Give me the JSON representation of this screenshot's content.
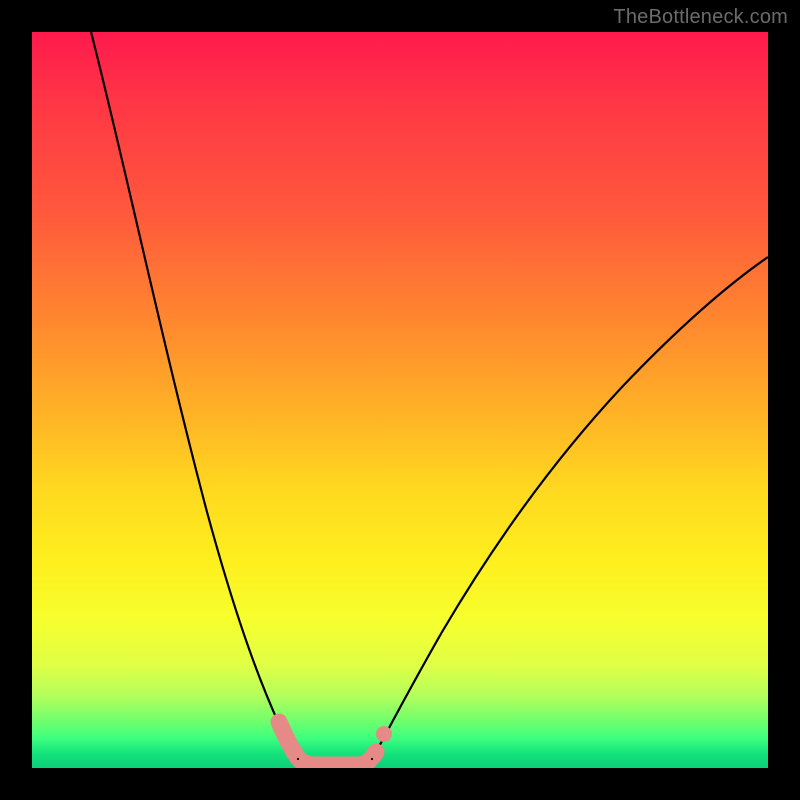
{
  "watermark": "TheBottleneck.com",
  "chart_data": {
    "type": "line",
    "title": "",
    "xlabel": "",
    "ylabel": "",
    "xlim": [
      0,
      100
    ],
    "ylim": [
      0,
      100
    ],
    "gradient_stops": [
      {
        "pos": 0,
        "color": "#ff1a4d"
      },
      {
        "pos": 25,
        "color": "#ff5a3c"
      },
      {
        "pos": 52,
        "color": "#ffb326"
      },
      {
        "pos": 72,
        "color": "#feef1e"
      },
      {
        "pos": 90,
        "color": "#b6ff5a"
      },
      {
        "pos": 100,
        "color": "#0ccf78"
      }
    ],
    "series": [
      {
        "name": "left-curve",
        "style": "thin-black",
        "points": [
          {
            "x": 8,
            "y": 100
          },
          {
            "x": 14,
            "y": 72
          },
          {
            "x": 20,
            "y": 47
          },
          {
            "x": 26,
            "y": 26
          },
          {
            "x": 30,
            "y": 14
          },
          {
            "x": 33,
            "y": 6
          },
          {
            "x": 36,
            "y": 1
          }
        ]
      },
      {
        "name": "right-curve",
        "style": "thin-black",
        "points": [
          {
            "x": 46,
            "y": 1
          },
          {
            "x": 50,
            "y": 8
          },
          {
            "x": 58,
            "y": 22
          },
          {
            "x": 68,
            "y": 38
          },
          {
            "x": 80,
            "y": 52
          },
          {
            "x": 92,
            "y": 63
          },
          {
            "x": 100,
            "y": 69
          }
        ]
      },
      {
        "name": "valley-floor",
        "style": "thick-salmon",
        "points": [
          {
            "x": 33,
            "y": 6
          },
          {
            "x": 34,
            "y": 3
          },
          {
            "x": 36,
            "y": 1
          },
          {
            "x": 40,
            "y": 0.5
          },
          {
            "x": 44,
            "y": 0.5
          },
          {
            "x": 46,
            "y": 1
          },
          {
            "x": 47,
            "y": 3
          }
        ]
      },
      {
        "name": "right-dot",
        "style": "salmon-dot",
        "points": [
          {
            "x": 48,
            "y": 6
          }
        ]
      }
    ],
    "annotations": []
  }
}
